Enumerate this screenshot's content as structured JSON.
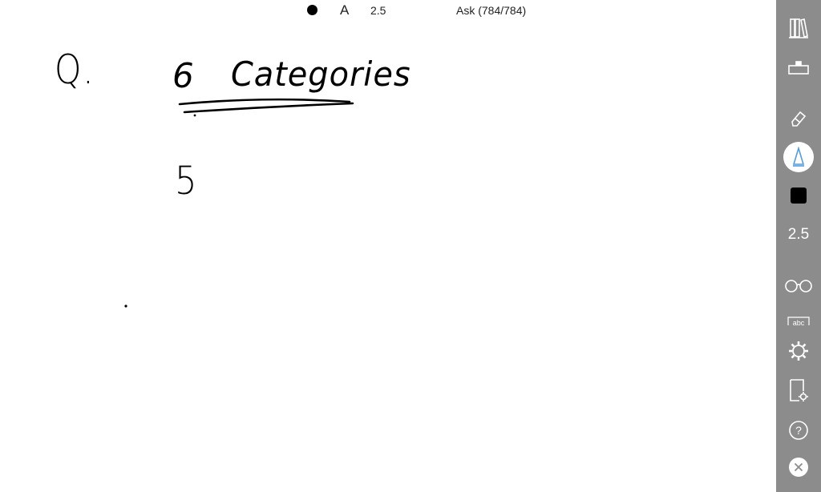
{
  "topbar": {
    "pen_glyph": "A",
    "pen_size": "2.5",
    "ask_label": "Ask (784/784)"
  },
  "canvas": {
    "question_label": "Q.",
    "number_six": "6",
    "title_word": "Categories",
    "number_five": "5"
  },
  "toolbar": {
    "pen_size": "2.5",
    "icons": [
      "library-icon",
      "ruler-icon",
      "eraser-icon",
      "pen-icon",
      "color-swatch",
      "pen-size",
      "glasses-icon",
      "text-recognition-icon",
      "settings-icon",
      "page-settings-icon",
      "help-icon",
      "close-icon"
    ],
    "accent_color": "#5a9bd5",
    "background_color": "#8c8c8c"
  }
}
